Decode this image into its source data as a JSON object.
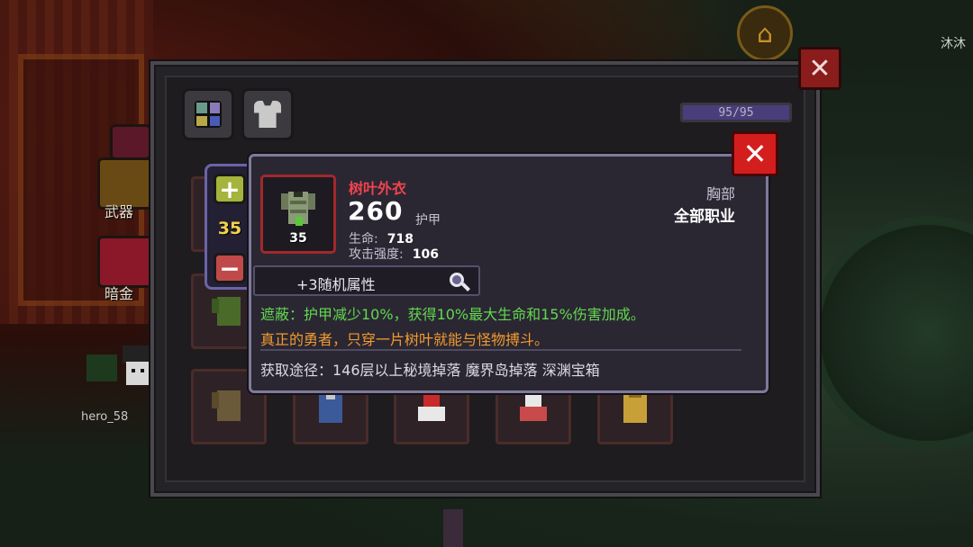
{
  "background": {
    "top_right_name": "沐沐",
    "player_name": "hero_58",
    "side_buttons": [
      "武器",
      "暗金"
    ]
  },
  "inventory": {
    "tabs": [
      {
        "name": "all-items",
        "icon": "grid-icon"
      },
      {
        "name": "armor",
        "icon": "armor-icon"
      }
    ],
    "capacity_text": "95/95",
    "capacity_fraction": 1.0,
    "close_icon": "✕"
  },
  "stepper": {
    "plus_label": "+",
    "minus_label": "−",
    "count": "35"
  },
  "tooltip": {
    "close_icon": "✕",
    "item_name": "树叶外衣",
    "item_level": "35",
    "armor_value": "260",
    "armor_label": "护甲",
    "stats": {
      "hp_label": "生命:",
      "hp_value": "718",
      "atk_label": "攻击强度:",
      "atk_value": "106"
    },
    "slot_type": "胸部",
    "class_requirement": "全部职业",
    "random_affix": "+3随机属性",
    "effect": "遮蔽：护甲减少10%，获得10%最大生命和15%伤害加成。",
    "flavor": "真正的勇者，只穿一片树叶就能与怪物搏斗。",
    "source": "获取途径：146层以上秘境掉落 魔界岛掉落 深渊宝箱"
  },
  "colors": {
    "item_name": "#f0444e",
    "effect": "#63d84e",
    "flavor": "#f39a2e",
    "count": "#f4d24a"
  }
}
